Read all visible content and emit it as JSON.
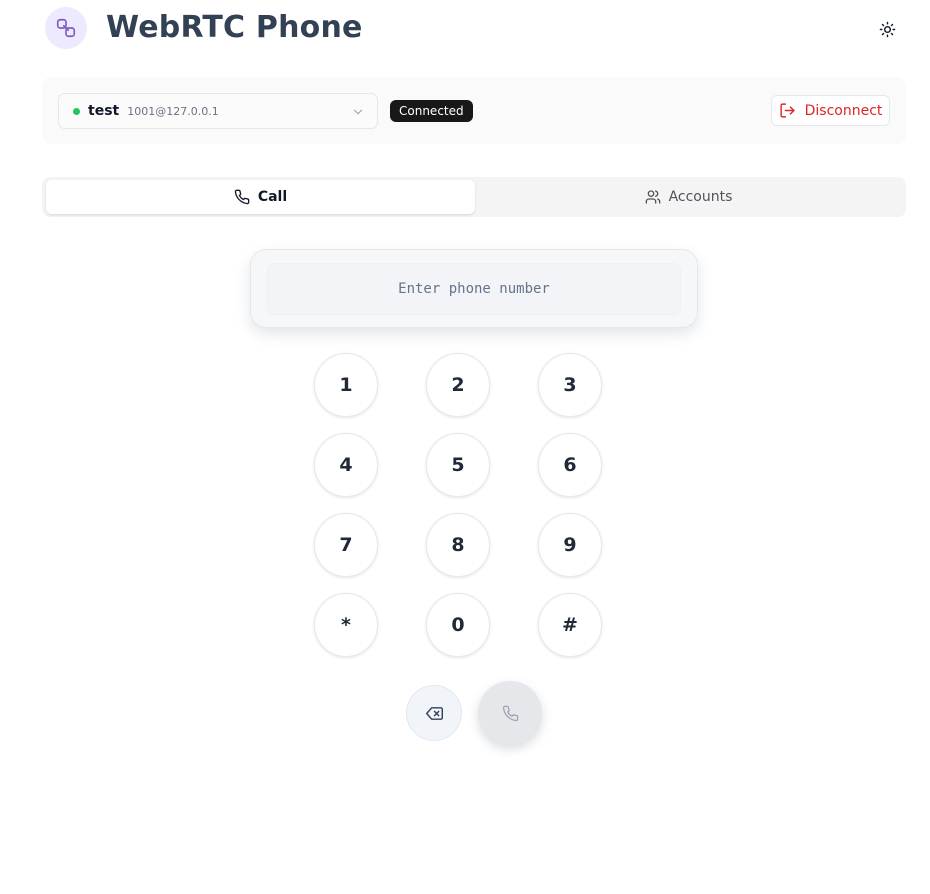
{
  "app": {
    "title": "WebRTC Phone",
    "logo_icon": "link-icon",
    "theme_icon": "sun-icon"
  },
  "account": {
    "name": "test",
    "uri": "1001@127.0.0.1",
    "status_color": "#22c55e",
    "status_badge": "Connected",
    "disconnect_label": "Disconnect"
  },
  "tabs": [
    {
      "label": "Call",
      "icon": "phone-icon",
      "active": true
    },
    {
      "label": "Accounts",
      "icon": "users-icon",
      "active": false
    }
  ],
  "dialer": {
    "input_value": "",
    "placeholder": "Enter phone number",
    "keys": [
      "1",
      "2",
      "3",
      "4",
      "5",
      "6",
      "7",
      "8",
      "9",
      "*",
      "0",
      "#"
    ],
    "backspace_icon": "backspace-icon",
    "call_icon": "phone-icon"
  },
  "colors": {
    "accent": "#7c5cc4",
    "danger": "#dc2626",
    "badge_bg": "#18181b"
  }
}
